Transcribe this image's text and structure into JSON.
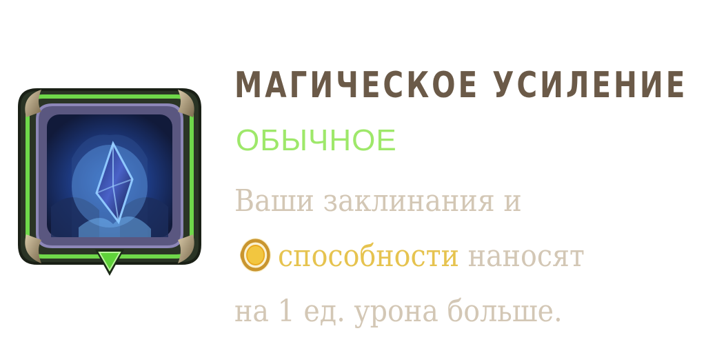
{
  "card": {
    "title": "МАГИЧЕСКОЕ УСИЛЕНИЕ",
    "rarity": "ОБЫЧНОЕ",
    "description": {
      "line1": "Ваши заклинания и",
      "keyword": "способности",
      "line2_rest": " наносят",
      "line3": "на 1 ед. урона больше."
    },
    "icons": {
      "augment": "crystal-augment-icon",
      "rarity_marker": "green-triangle-icon",
      "keyword": "ability-ring-icon"
    },
    "colors": {
      "title": "#6b5a48",
      "rarity": "#9ee86a",
      "description": "#d3c7b5",
      "keyword": "#e6c34f",
      "frame_green": "#6fd84a",
      "frame_dark": "#2a3425"
    }
  }
}
